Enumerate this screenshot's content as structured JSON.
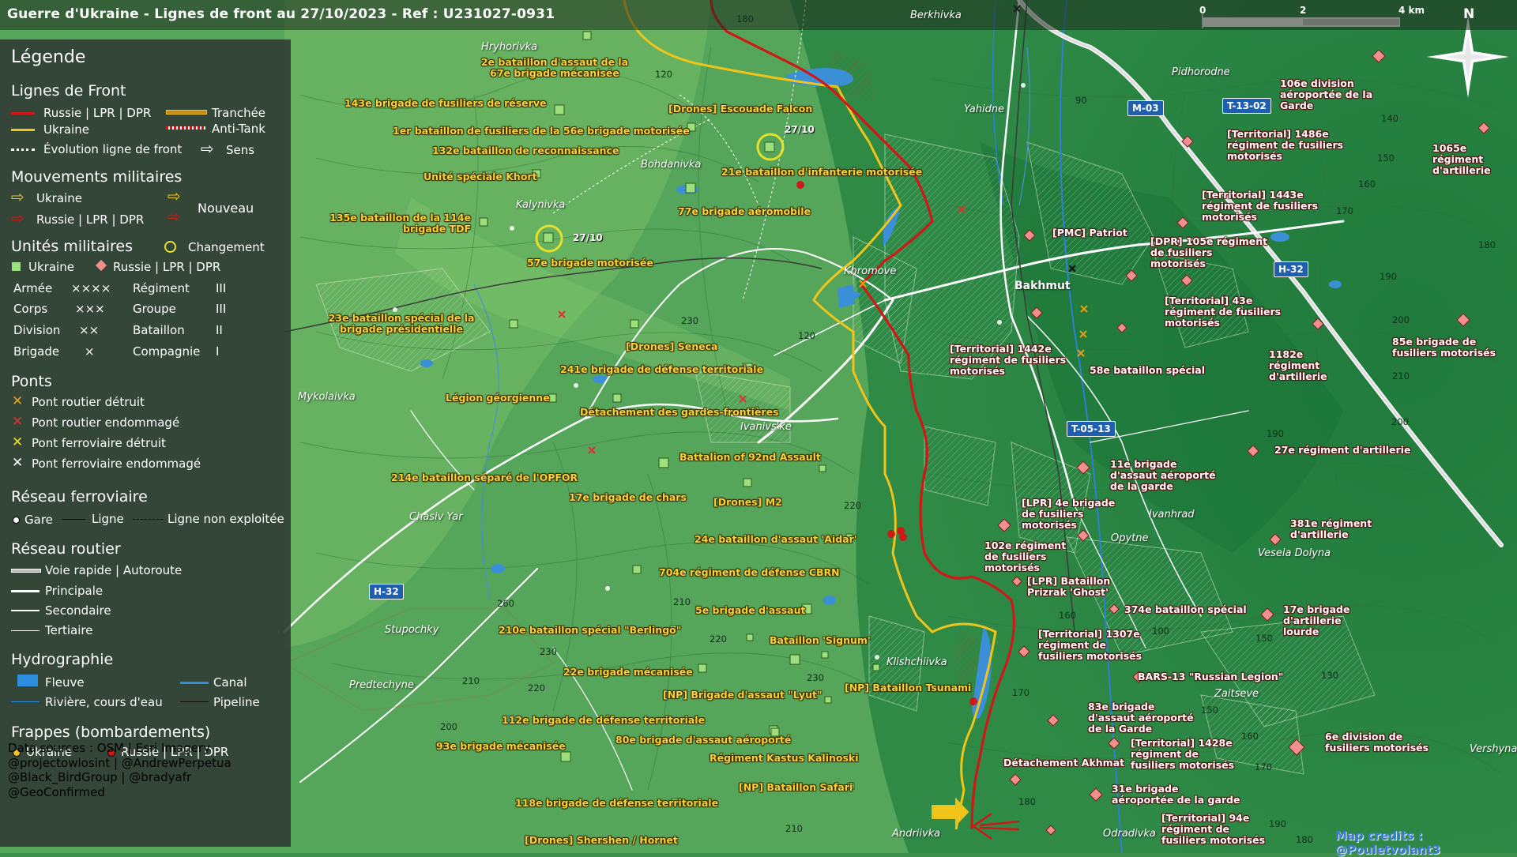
{
  "title": "Guerre d'Ukraine - Lignes de front au 27/10/2023 - Ref : U231027-0931",
  "credit": "Map credits : @Pouletvolant3",
  "scale": {
    "labels": [
      "0",
      "2",
      "4 km"
    ]
  },
  "north": "N",
  "colors": {
    "russia": "#d01818",
    "ukraine": "#f0c419",
    "legend_bg": "#2d3732",
    "unit_ua": "#9be07a",
    "unit_ru": "#f48f8f"
  },
  "legend": {
    "title": "Légende",
    "front": {
      "title": "Lignes de Front",
      "russia": "Russie | LPR | DPR",
      "ukraine": "Ukraine",
      "evolution": "Évolution ligne de front",
      "trench": "Tranchée",
      "antitank": "Anti-Tank",
      "direction": "Sens"
    },
    "moves": {
      "title": "Mouvements militaires",
      "ukraine": "Ukraine",
      "russia": "Russie | LPR | DPR",
      "new": "Nouveau"
    },
    "units": {
      "title": "Unités militaires",
      "change": "Changement",
      "ukraine": "Ukraine",
      "russia": "Russie | LPR | DPR",
      "rows": [
        {
          "a": "Armée",
          "as": "××××",
          "b": "Régiment",
          "bs": "III"
        },
        {
          "a": "Corps",
          "as": "×××",
          "b": "Groupe",
          "bs": "III"
        },
        {
          "a": "Division",
          "as": "××",
          "b": "Bataillon",
          "bs": "II"
        },
        {
          "a": "Brigade",
          "as": "×",
          "b": "Compagnie",
          "bs": "I"
        }
      ]
    },
    "bridges": {
      "title": "Ponts",
      "items": [
        "Pont routier détruit",
        "Pont routier endommagé",
        "Pont ferroviaire détruit",
        "Pont ferroviaire endommagé"
      ]
    },
    "rail": {
      "title": "Réseau ferroviaire",
      "station": "Gare",
      "line": "Ligne",
      "unused": "Ligne non exploitée"
    },
    "roads": {
      "title": "Réseau routier",
      "items": [
        "Voie rapide | Autoroute",
        "Principale",
        "Secondaire",
        "Tertiaire"
      ]
    },
    "hydro": {
      "title": "Hydrographie",
      "river": "Fleuve",
      "stream": "Rivière, cours d'eau",
      "canal": "Canal",
      "pipeline": "Pipeline"
    },
    "strikes": {
      "title": "Frappes (bombardements)",
      "ukraine": "Ukraine",
      "russia": "Russie | LPR | DPR"
    }
  },
  "sources": [
    "Data sources : OSM | Esri Imagery",
    "@projectowlosint | @AndrewPerpetua",
    "@Black_BirdGroup | @bradyafr",
    "@GeoConfirmed"
  ],
  "roads": [
    "M-03",
    "T-13-02",
    "H-32",
    "T-05-13",
    "H-32"
  ],
  "dates": [
    "27/10",
    "27/10"
  ],
  "places": [
    "Hryhorivka",
    "Berkhivka",
    "Pidhorodne",
    "Yahidne",
    "Bohdanivka",
    "Kalynivka",
    "Khromove",
    "Bakhmut",
    "Mykolaivka",
    "Ivanivs'ke",
    "Chasiv Yar",
    "Ivanhrad",
    "Opytne",
    "Vesela Dolyna",
    "Stupochky",
    "Predtechyne",
    "Klishchiivka",
    "Zaitseve",
    "Andriivka",
    "Odradivka",
    "Vershyna"
  ],
  "ua_units": [
    "2e bataillon d'assaut de la 67e brigade mécanisée",
    "143e brigade de fusiliers de réserve",
    "[Drones] Escouade Falcon",
    "1er bataillon de fusiliers de la 56e brigade motorisée",
    "132e bataillon de reconnaissance",
    "21e bataillon d'infanterie motorisée",
    "Unité spéciale Khort",
    "77e brigade aéromobile",
    "135e bataillon de la 114e brigade TDF",
    "57e brigade motorisée",
    "23e bataillon spécial de la brigade présidentielle",
    "[Drones] Seneca",
    "241e brigade de défense territoriale",
    "Légion géorgienne",
    "Détachement des gardes-frontières",
    "Battalion of 92nd Assault",
    "214e bataillon séparé de l'OPFOR",
    "17e brigade de chars",
    "[Drones] M2",
    "24e bataillon d'assaut 'Aidar'",
    "704e régiment de défense CBRN",
    "5e brigade d'assaut",
    "210e bataillon spécial \"Berlingo\"",
    "Bataillon 'Signum'",
    "22e brigade mécanisée",
    "[NP] Bataillon Tsunami",
    "[NP] Brigade d'assaut \"Lyut\"",
    "112e brigade de défense territoriale",
    "80e brigade d'assaut aéroporté",
    "93e brigade mécanisée",
    "Régiment Kastus Kalinoski",
    "[NP] Bataillon Safari",
    "118e brigade de défense territoriale",
    "[Drones] Shershen / Hornet"
  ],
  "ru_units": [
    "106e division aéroportée de la Garde",
    "[Territorial] 1486e régiment de fusiliers motorisés",
    "1065e régiment d'artillerie",
    "[Territorial] 1443e régiment de fusiliers motorisés",
    "[PMC] Patriot",
    "[DPR] 105e régiment de fusiliers motorisés",
    "[Territorial] 43e régiment de fusiliers motorisés",
    "85e brigade de fusiliers motorisés",
    "1182e régiment d'artillerie",
    "[Territorial] 1442e régiment de fusiliers motorisés",
    "58e bataillon spécial",
    "27e régiment d'artillerie",
    "11e brigade d'assaut aéroporté de la garde",
    "[LPR] 4e brigade de fusiliers motorisés",
    "381e régiment d'artillerie",
    "102e régiment de fusiliers motorisés",
    "[LPR] Bataillon Prizrak 'Ghost'",
    "374e bataillon spécial",
    "17e brigade d'artillerie lourde",
    "[Territorial] 1307e régiment de fusiliers motorisés",
    "BARS-13 \"Russian Legion\"",
    "83e brigade d'assaut aéroporté de la Garde",
    "[Territorial] 1428e régiment de fusiliers motorisés",
    "6e division de fusiliers motorisés",
    "Détachement Akhmat",
    "31e brigade aéroportée de la garde",
    "[Territorial] 94e régiment de fusiliers motorisés"
  ],
  "elevations": [
    "180",
    "120",
    "90",
    "140",
    "150",
    "160",
    "170",
    "230",
    "120",
    "180",
    "190",
    "200",
    "210",
    "200",
    "220",
    "190",
    "160",
    "150",
    "260",
    "210",
    "220",
    "230",
    "210",
    "220",
    "200",
    "230",
    "170",
    "150",
    "160",
    "170",
    "180",
    "190",
    "130",
    "180",
    "210",
    "100"
  ]
}
